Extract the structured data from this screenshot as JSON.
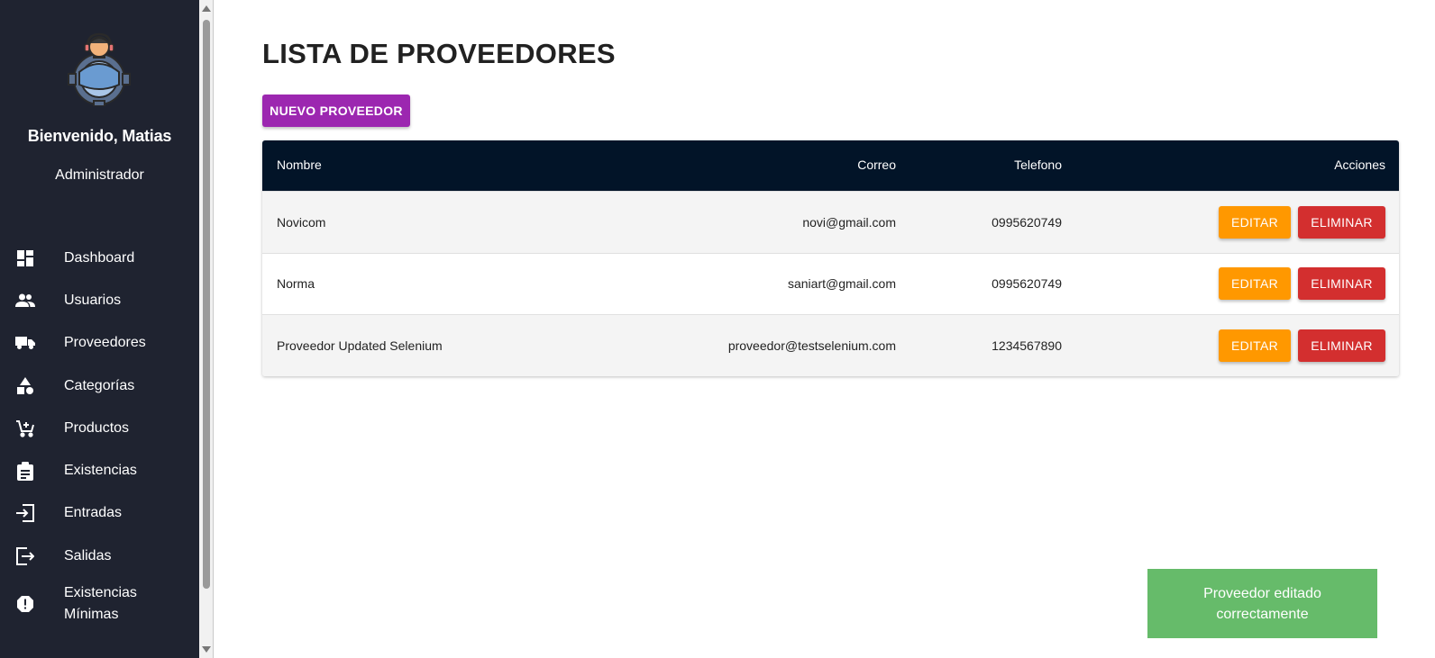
{
  "sidebar": {
    "welcome": "Bienvenido, Matias",
    "role": "Administrador",
    "items": [
      {
        "label": "Dashboard",
        "icon": "dashboard-icon"
      },
      {
        "label": "Usuarios",
        "icon": "users-icon"
      },
      {
        "label": "Proveedores",
        "icon": "truck-icon"
      },
      {
        "label": "Categorías",
        "icon": "category-shapes-icon"
      },
      {
        "label": "Productos",
        "icon": "cart-icon"
      },
      {
        "label": "Existencias",
        "icon": "clipboard-icon"
      },
      {
        "label": "Entradas",
        "icon": "login-icon"
      },
      {
        "label": "Salidas",
        "icon": "logout-icon"
      },
      {
        "label": "Existencias Mínimas",
        "icon": "alert-icon"
      }
    ]
  },
  "main": {
    "title": "LISTA DE PROVEEDORES",
    "new_button": "NUEVO PROVEEDOR",
    "table": {
      "headers": {
        "name": "Nombre",
        "email": "Correo",
        "phone": "Telefono",
        "actions": "Acciones"
      },
      "rows": [
        {
          "name": "Novicom",
          "email": "novi@gmail.com",
          "phone": "0995620749"
        },
        {
          "name": "Norma",
          "email": "saniart@gmail.com",
          "phone": "0995620749"
        },
        {
          "name": "Proveedor Updated Selenium",
          "email": "proveedor@testselenium.com",
          "phone": "1234567890"
        }
      ],
      "edit_label": "EDITAR",
      "delete_label": "ELIMINAR"
    }
  },
  "toast": {
    "message": "Proveedor editado correctamente"
  },
  "colors": {
    "sidebar_bg": "#1f2330",
    "table_header_bg": "#021428",
    "primary_purple": "#9c27b0",
    "edit_orange": "#ff9800",
    "delete_red": "#d32f2f",
    "toast_green": "#66bb6a"
  }
}
